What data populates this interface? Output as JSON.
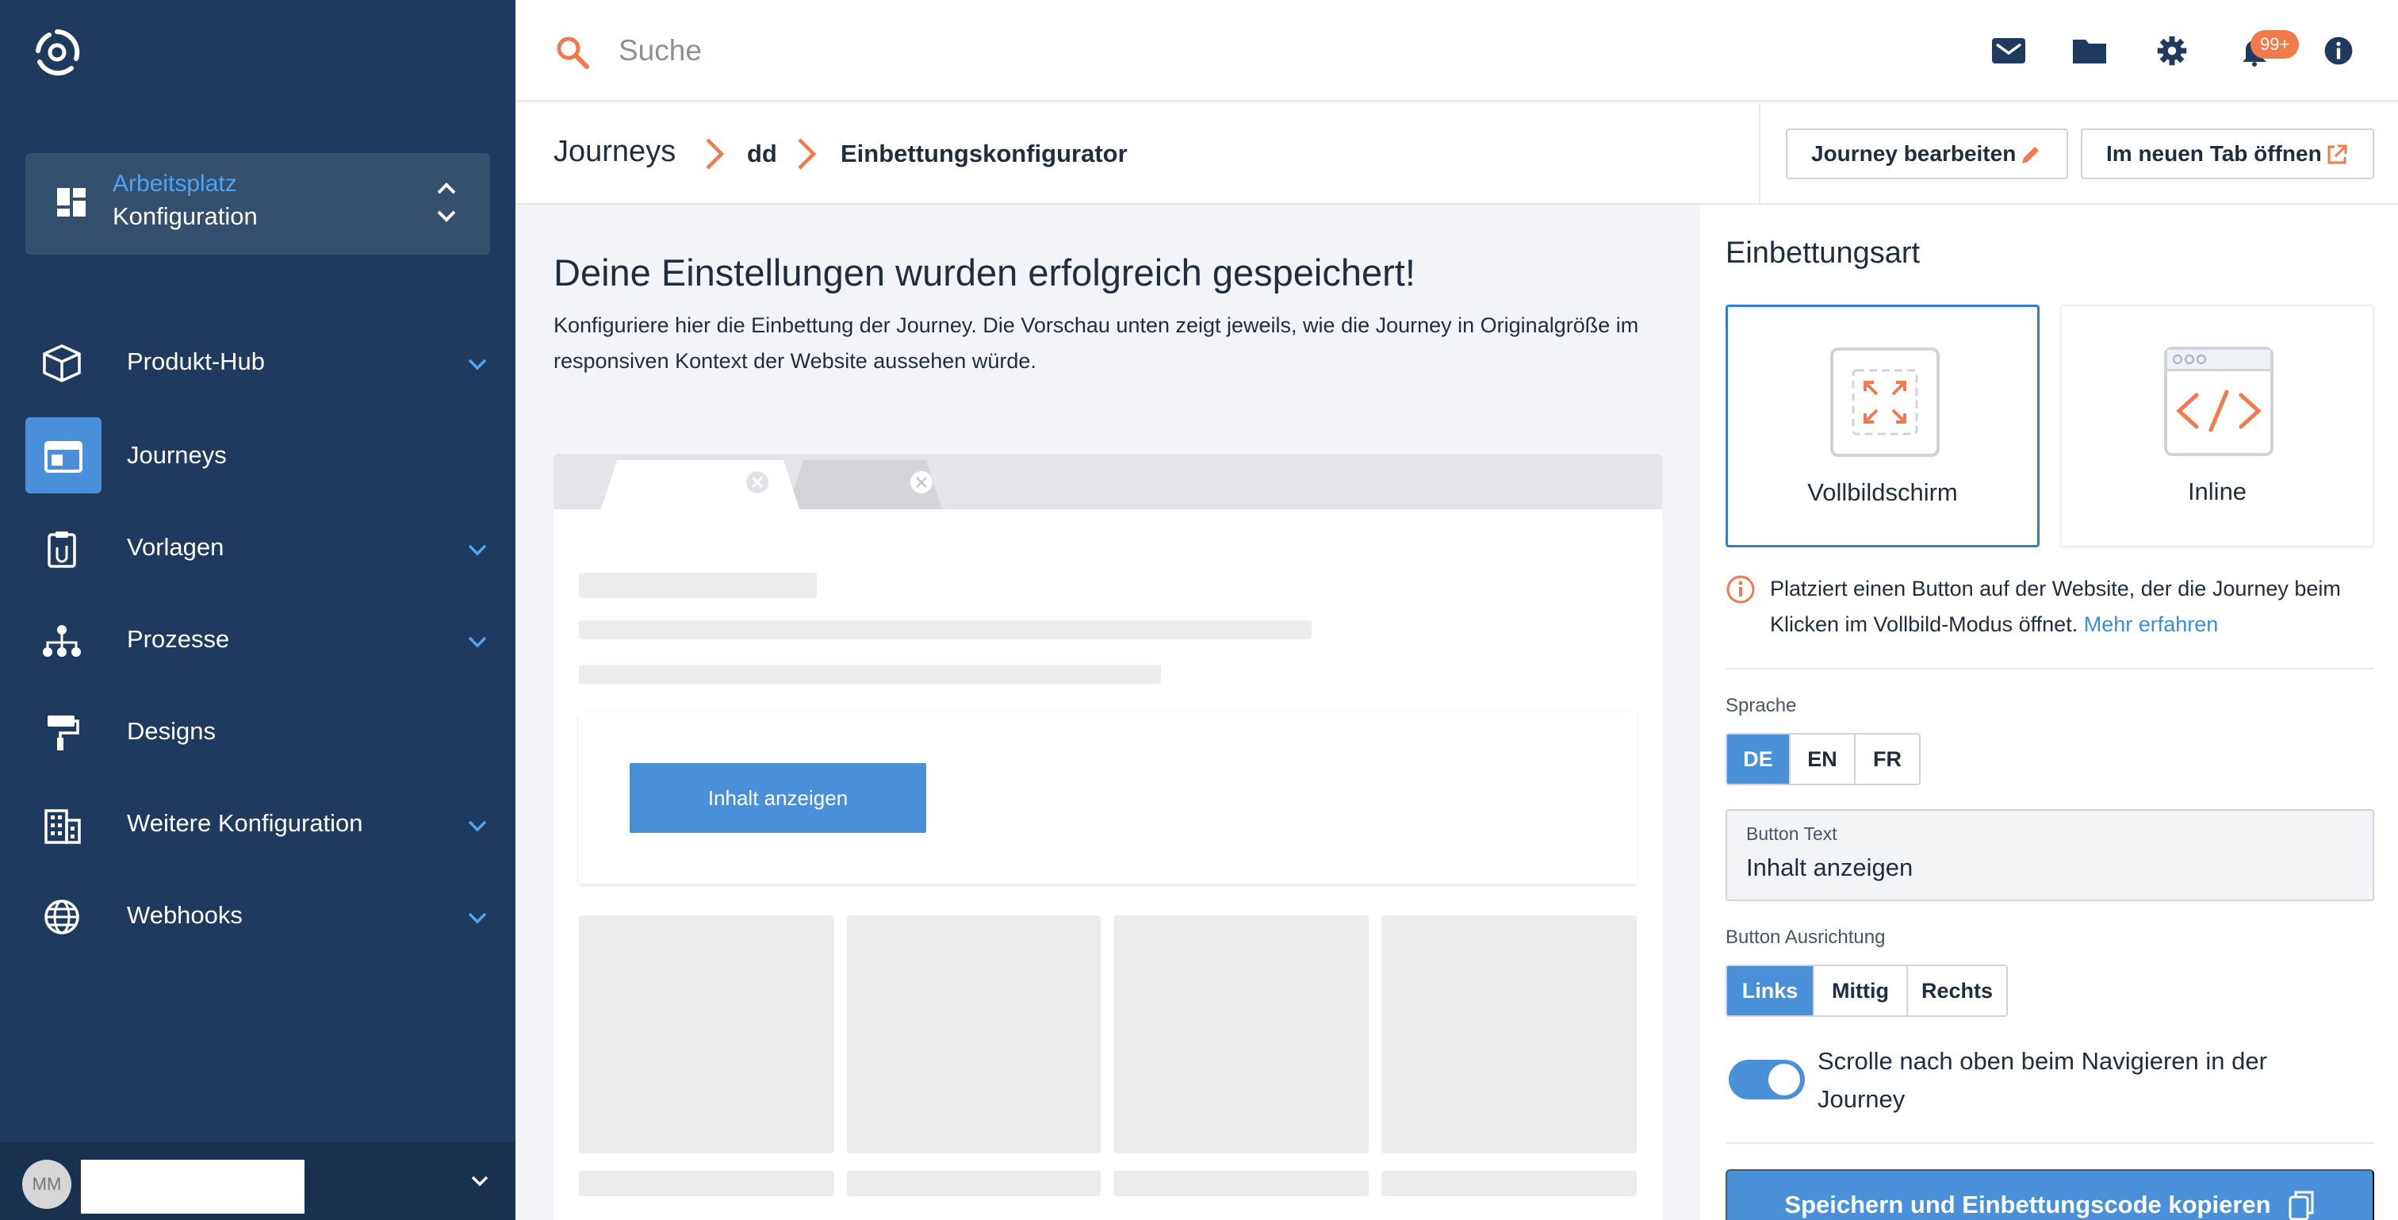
{
  "sidebar": {
    "workspace": {
      "title": "Arbeitsplatz",
      "subtitle": "Konfiguration"
    },
    "items": [
      {
        "label": "Produkt-Hub",
        "icon": "box-icon",
        "has_submenu": true
      },
      {
        "label": "Journeys",
        "icon": "browser-window-icon",
        "active": true
      },
      {
        "label": "Vorlagen",
        "icon": "clipboard-icon",
        "has_submenu": true
      },
      {
        "label": "Prozesse",
        "icon": "hierarchy-icon",
        "has_submenu": true
      },
      {
        "label": "Designs",
        "icon": "paint-roller-icon"
      },
      {
        "label": "Weitere Konfiguration",
        "icon": "building-icon",
        "has_submenu": true
      },
      {
        "label": "Webhooks",
        "icon": "globe-icon",
        "has_submenu": true
      }
    ],
    "user": {
      "initials": "MM"
    }
  },
  "topbar": {
    "search_placeholder": "Suche",
    "notification_count": "99+",
    "icons": [
      "mail-icon",
      "folder-icon",
      "gear-icon",
      "bell-icon",
      "info-icon"
    ]
  },
  "breadcrumb": {
    "root": "Journeys",
    "middle": "dd",
    "current": "Einbettungskonfigurator"
  },
  "actions": {
    "edit_journey": "Journey bearbeiten",
    "open_new_tab": "Im neuen Tab öffnen"
  },
  "main": {
    "heading": "Deine Einstellungen wurden erfolgreich gespeichert!",
    "description": "Konfiguriere hier die Einbettung der Journey. Die Vorschau unten zeigt jeweils, wie die Journey in Originalgröße im responsiven Kontext der Website aussehen würde.",
    "preview_button": "Inhalt anzeigen"
  },
  "panel": {
    "title": "Einbettungsart",
    "options": [
      {
        "label": "Vollbildschirm",
        "selected": true
      },
      {
        "label": "Inline",
        "selected": false
      }
    ],
    "info_text": "Platziert einen Button auf der Website, der die Journey beim Klicken im Vollbild-Modus öffnet.",
    "info_link": "Mehr erfahren",
    "language_label": "Sprache",
    "languages": [
      "DE",
      "EN",
      "FR"
    ],
    "language_selected": "DE",
    "button_text_label": "Button Text",
    "button_text_value": "Inhalt anzeigen",
    "alignment_label": "Button Ausrichtung",
    "alignments": [
      "Links",
      "Mittig",
      "Rechts"
    ],
    "alignment_selected": "Links",
    "scroll_toggle_label": "Scrolle nach oben beim Navigieren in der Journey",
    "scroll_toggle_on": true,
    "save_button": "Speichern und Einbettungscode kopieren"
  },
  "colors": {
    "sidebar_bg": "#1e3a5f",
    "accent_blue": "#4a90d9",
    "accent_orange": "#f07a4b"
  }
}
